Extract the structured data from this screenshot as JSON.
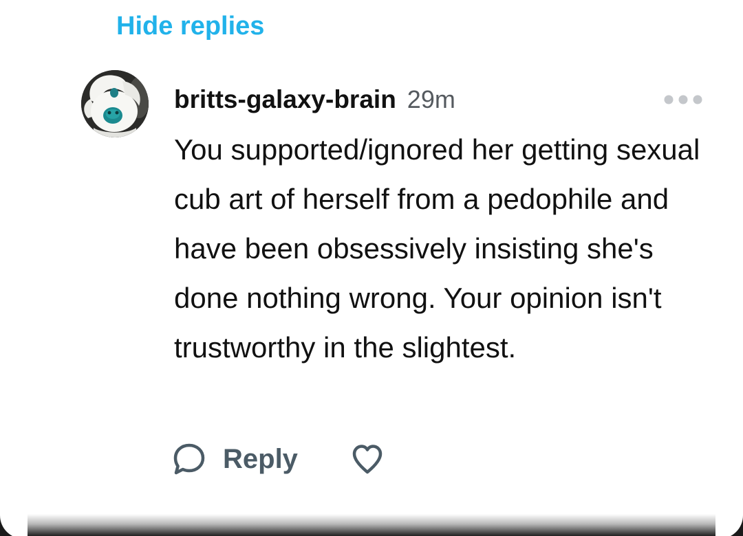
{
  "replies_toggle": {
    "label": "Hide replies"
  },
  "comment": {
    "avatar_icon": "absol-figure-avatar",
    "username": "britts-galaxy-brain",
    "timestamp": "29m",
    "more_icon": "more-dots-icon",
    "text": "You supported/ignored her getting sexual cub art of herself from a pedophile and have been obsessively insisting she's done nothing wrong. Your opinion isn't trustworthy in the slightest.",
    "actions": {
      "reply_icon": "speech-bubble-icon",
      "reply_label": "Reply",
      "like_icon": "heart-outline-icon"
    }
  },
  "colors": {
    "accent": "#21b2ea",
    "text": "#111111",
    "muted": "#555a5f",
    "action": "#4b5b66"
  }
}
